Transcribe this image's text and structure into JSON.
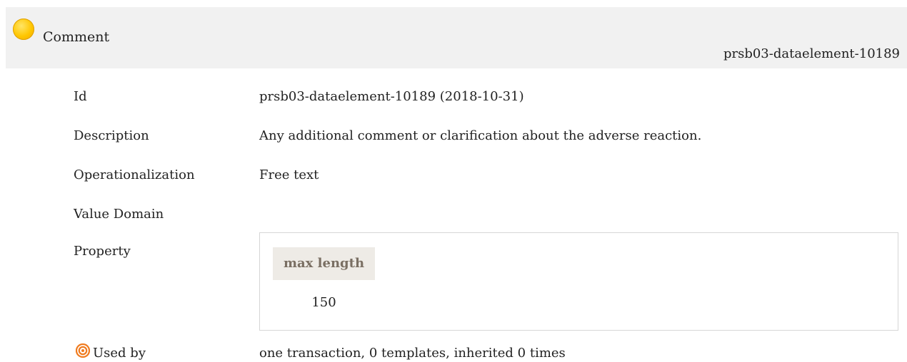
{
  "header": {
    "title": "Comment",
    "identifier": "prsb03-dataelement-10189",
    "status_icon": "yellow-status-circle",
    "status_color": "#ffc600"
  },
  "rows": {
    "id": {
      "label": "Id",
      "value": "prsb03-dataelement-10189 (2018-10-31)"
    },
    "description": {
      "label": "Description",
      "value": "Any additional comment or clarification about the adverse reaction."
    },
    "operationalization": {
      "label": "Operationalization",
      "value": "Free text"
    },
    "value_domain": {
      "label": "Value Domain",
      "value": ""
    },
    "property": {
      "label": "Property"
    }
  },
  "property": {
    "header": "max length",
    "value": "150"
  },
  "used_by": {
    "label": "Used by",
    "icon": "target-icon",
    "icon_color": "#f07b1e",
    "value": "one transaction, 0 templates, inherited 0 times"
  }
}
